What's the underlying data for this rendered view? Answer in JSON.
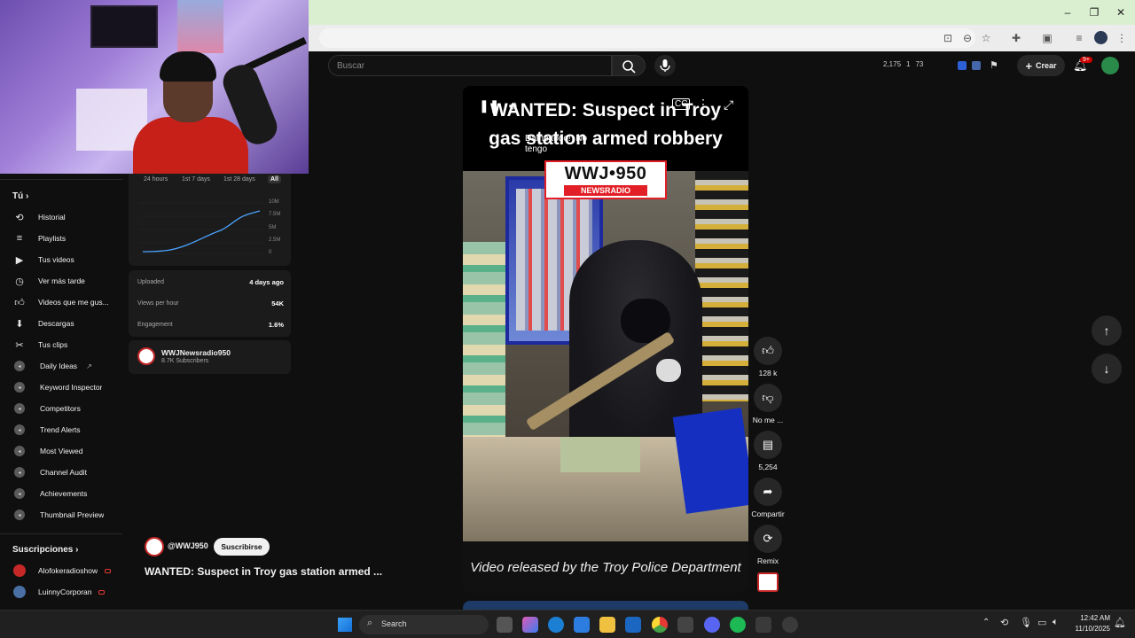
{
  "browser": {
    "window_controls": {
      "minimize": "–",
      "maximize": "❐",
      "close": "✕"
    }
  },
  "masthead": {
    "search_placeholder": "Buscar",
    "stats": {
      "stat1": "2,175",
      "stat2": "1",
      "stat3": "73"
    },
    "create_label": "Crear",
    "notifications_badge": "9+"
  },
  "sidebar": {
    "you_heading": "Tú",
    "you_items": [
      {
        "label": "Historial",
        "icon": "history-icon"
      },
      {
        "label": "Playlists",
        "icon": "playlists-icon"
      },
      {
        "label": "Tus videos",
        "icon": "your-videos-icon"
      },
      {
        "label": "Ver más tarde",
        "icon": "watch-later-icon"
      },
      {
        "label": "Videos que me gus...",
        "icon": "liked-videos-icon"
      },
      {
        "label": "Descargas",
        "icon": "downloads-icon"
      },
      {
        "label": "Tus clips",
        "icon": "clips-icon"
      }
    ],
    "tool_items": [
      "Daily Ideas",
      "Keyword Inspector",
      "Competitors",
      "Trend Alerts",
      "Most Viewed",
      "Channel Audit",
      "Achievements",
      "Thumbnail Preview"
    ],
    "subs_heading": "Suscripciones",
    "subscriptions": [
      {
        "name": "Alofokeradioshow",
        "color": "#c62828"
      },
      {
        "name": "LuinnyCorporan",
        "color": "#4a6fa5"
      }
    ]
  },
  "stats_panel": {
    "tabs": [
      "24 hours",
      "1st 7 days",
      "1st 28 days",
      "All"
    ],
    "active_tab": "All",
    "y_labels": [
      "10M",
      "7.5M",
      "5M",
      "2.5M",
      "0"
    ],
    "rows": [
      {
        "label": "Uploaded",
        "value": "4 days ago"
      },
      {
        "label": "Views per hour",
        "value": "54K"
      },
      {
        "label": "Engagement",
        "value": "1.6%"
      }
    ],
    "channel_name": "WWJNewsradio950",
    "channel_subs": "8.7K Subscribers"
  },
  "video": {
    "headline_line1": "WANTED: Suspect in Troy",
    "headline_line2": "gas station armed robbery",
    "tooltip": "Dame todo!  No\ntengo",
    "logo_top": "WWJ•950",
    "logo_bottom": "NEWSRADIO",
    "caption": "Video released by the Troy Police Department"
  },
  "actions": {
    "like_count": "128 k",
    "dislike_label": "No me ...",
    "comments_count": "5,254",
    "share_label": "Compartir",
    "remix_label": "Remix"
  },
  "below_video": {
    "channel_handle": "@WWJ950",
    "subscribe_label": "Suscribirse",
    "title": "WANTED: Suspect in Troy gas station armed ..."
  },
  "taskbar": {
    "search_label": "Search",
    "time": "12:42 AM",
    "date": "11/10/2025"
  }
}
